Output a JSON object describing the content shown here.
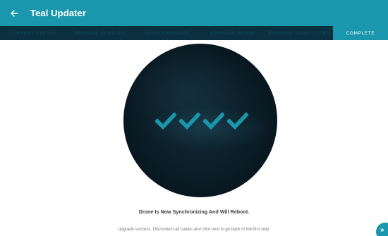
{
  "appbar": {
    "back_icon": "arrow-left-icon",
    "title": "Teal Updater"
  },
  "tabs": [
    {
      "label": "CURRENT STATUS",
      "active": false
    },
    {
      "label": "PREPARE UPGRADE",
      "active": false
    },
    {
      "label": "COPY FIRMWARE",
      "active": false
    },
    {
      "label": "UPGRADE DRONE",
      "active": false
    },
    {
      "label": "UPGRADE SUBSYSTEMS",
      "active": false
    },
    {
      "label": "COMPLETE",
      "active": true
    }
  ],
  "main": {
    "status_message": "Drone Is Now Synchronizing And Will Reboot.",
    "hint": "Upgrade success. Disconnect all cables and click next to go back to the first step.",
    "check_count": 4
  },
  "next_button": {
    "icon": "double-chevron-right-icon",
    "glyph": "»"
  },
  "colors": {
    "accent": "#1a97ad",
    "tab_bar": "#0a2f3e",
    "tab_text_inactive": "#0e465a",
    "check": "#1a97ad"
  }
}
